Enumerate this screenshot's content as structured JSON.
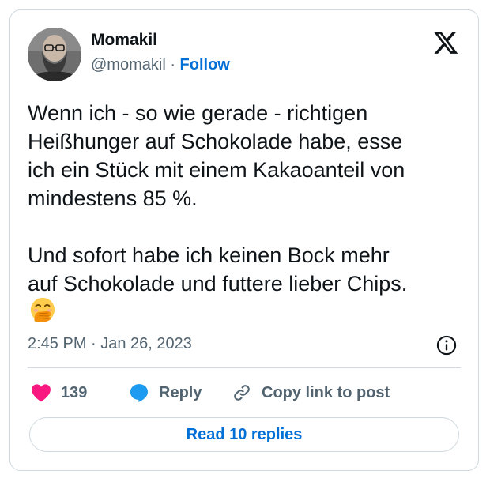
{
  "author": {
    "display_name": "Momakil",
    "handle": "@momakil",
    "separator": " · ",
    "follow_label": "Follow",
    "avatar_icon": "bearded-man-avatar"
  },
  "platform_icon": "x-logo-icon",
  "tweet": {
    "text": "Wenn ich - so wie gerade - richtigen\nHeißhunger auf Schokolade habe, esse\nich ein Stück mit einem Kakaoanteil von\nmindestens 85 %.\n\nUnd sofort habe ich keinen Bock mehr\nauf Schokolade und futtere lieber Chips.",
    "emoji": "face-with-hand-over-mouth-emoji",
    "timestamp": "2:45 PM · Jan 26, 2023"
  },
  "actions": {
    "like_count": "139",
    "reply_label": "Reply",
    "copy_link_label": "Copy link to post"
  },
  "read_replies_label": "Read 10 replies",
  "colors": {
    "accent_blue": "#006fd6",
    "like_pink": "#f91880",
    "reply_blue": "#1d9bf0",
    "secondary_text": "#536471",
    "border": "#cfd9de"
  }
}
